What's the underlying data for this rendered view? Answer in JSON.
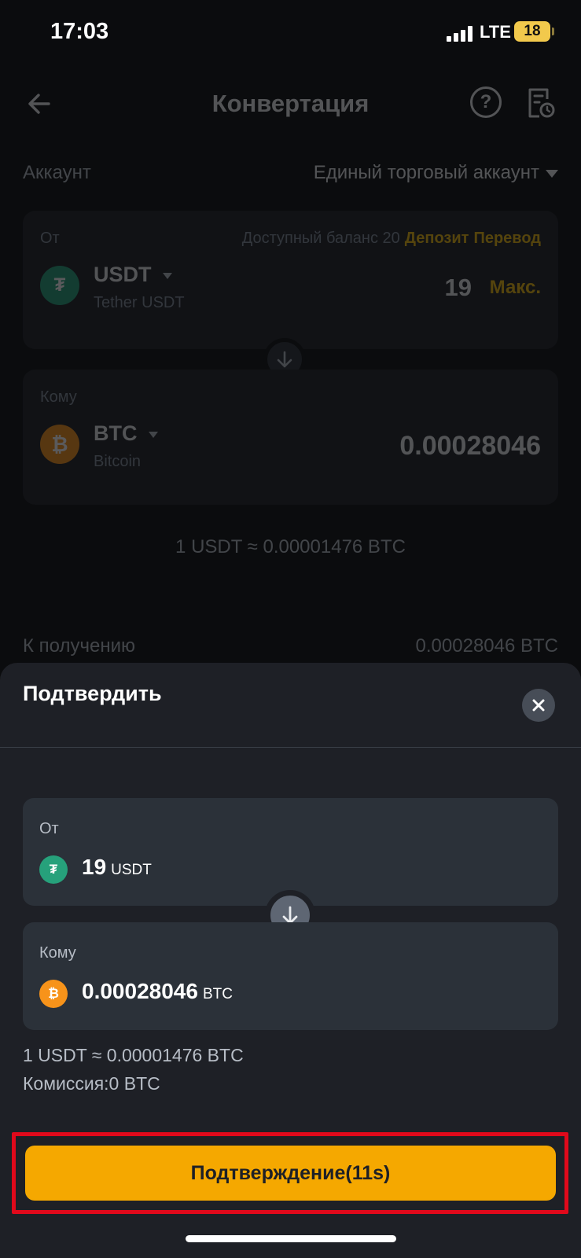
{
  "status_bar": {
    "time": "17:03",
    "network": "LTE",
    "battery": "18"
  },
  "header": {
    "title": "Конвертация",
    "help_glyph": "?"
  },
  "account": {
    "label": "Аккаунт",
    "value": "Единый торговый аккаунт"
  },
  "from_card": {
    "label": "От",
    "balance_text": "Доступный баланс 20",
    "deposit_link": "Депозит",
    "transfer_link": "Перевод",
    "coin": "USDT",
    "coin_name": "Tether USDT",
    "amount": "19",
    "max_label": "Макс."
  },
  "to_card": {
    "label": "Кому",
    "coin": "BTC",
    "coin_name": "Bitcoin",
    "amount": "0.00028046"
  },
  "rate": "1 USDT ≈ 0.00001476 BTC",
  "receive": {
    "label": "К получению",
    "value": "0.00028046 BTC"
  },
  "sheet": {
    "title": "Подтвердить",
    "from": {
      "label": "От",
      "amount": "19",
      "unit": "USDT"
    },
    "to": {
      "label": "Кому",
      "amount": "0.00028046",
      "unit": "BTC"
    },
    "rate": "1 USDT ≈ 0.00001476 BTC",
    "fee": "Комиссия:0 BTC",
    "confirm_label": "Подтверждение(11s)"
  },
  "icons": {
    "back": "arrow-left-icon",
    "help": "question-circle-icon",
    "history": "order-history-icon",
    "swap": "arrow-down-icon",
    "close": "close-icon",
    "usdt": "tether-logo-icon",
    "btc": "bitcoin-logo-icon"
  },
  "colors": {
    "accent": "#f0b90b",
    "button": "#f5a800",
    "highlight": "#e0091b",
    "usdt": "#26a17b",
    "btc": "#f7931a"
  }
}
